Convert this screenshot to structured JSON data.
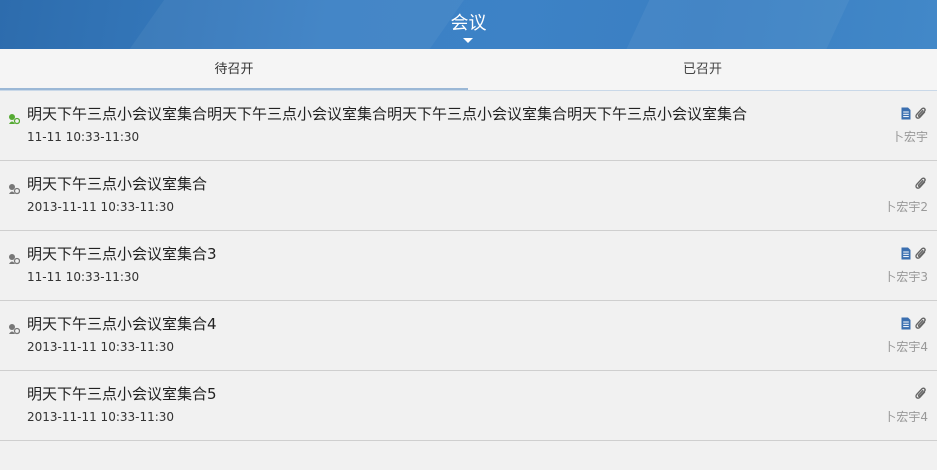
{
  "header": {
    "title": "会议"
  },
  "tabs": [
    {
      "label": "待召开",
      "active": true
    },
    {
      "label": "已召开",
      "active": false
    }
  ],
  "colors": {
    "header": "#3a80c4",
    "status_active": "#55aa33",
    "status_inactive": "#777777",
    "doc_icon": "#3b6fb0"
  },
  "meetings": [
    {
      "title": "明天下午三点小会议室集合明天下午三点小会议室集合明天下午三点小会议室集合明天下午三点小会议室集合",
      "time": "11-11 10:33-11:30",
      "owner": "卜宏宇",
      "status": "active",
      "doc": true,
      "attachment": true
    },
    {
      "title": "明天下午三点小会议室集合",
      "time": "2013-11-11 10:33-11:30",
      "owner": "卜宏宇2",
      "status": "inactive",
      "doc": false,
      "attachment": true
    },
    {
      "title": "明天下午三点小会议室集合3",
      "time": "11-11 10:33-11:30",
      "owner": "卜宏宇3",
      "status": "inactive",
      "doc": true,
      "attachment": true
    },
    {
      "title": "明天下午三点小会议室集合4",
      "time": "2013-11-11 10:33-11:30",
      "owner": "卜宏宇4",
      "status": "inactive",
      "doc": true,
      "attachment": true
    },
    {
      "title": "明天下午三点小会议室集合5",
      "time": "2013-11-11 10:33-11:30",
      "owner": "卜宏宇4",
      "status": "none",
      "doc": false,
      "attachment": true
    }
  ]
}
